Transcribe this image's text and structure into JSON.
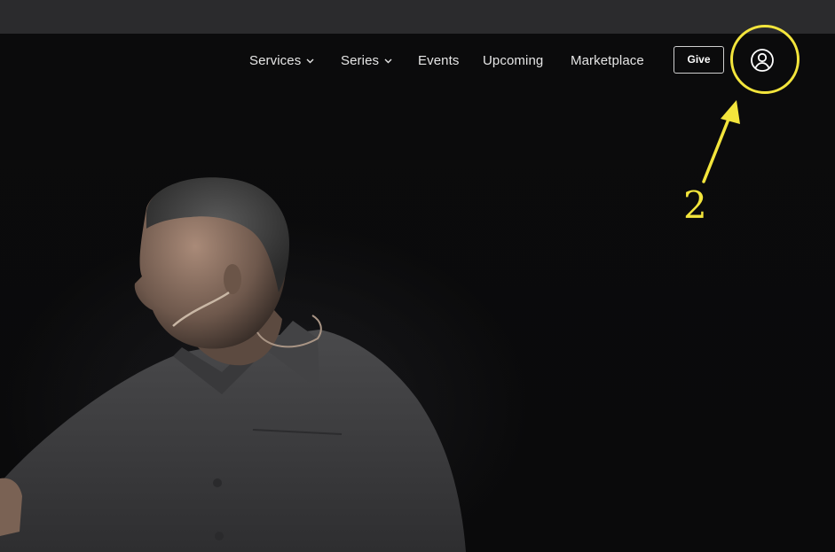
{
  "nav": {
    "items": [
      {
        "label": "Services",
        "has_dropdown": true
      },
      {
        "label": "Series",
        "has_dropdown": true
      },
      {
        "label": "Events",
        "has_dropdown": false
      },
      {
        "label": "Upcoming",
        "has_dropdown": false
      },
      {
        "label": "Marketplace",
        "has_dropdown": false
      }
    ],
    "give_label": "Give",
    "account_icon": "user-circle-icon"
  },
  "annotation": {
    "step_number": "2",
    "color": "#f3e53c"
  },
  "colors": {
    "topbar": "#2b2b2d",
    "background": "#0a0a0b",
    "nav_text": "#e6e6e6",
    "shirt": "#3a3a3c"
  }
}
